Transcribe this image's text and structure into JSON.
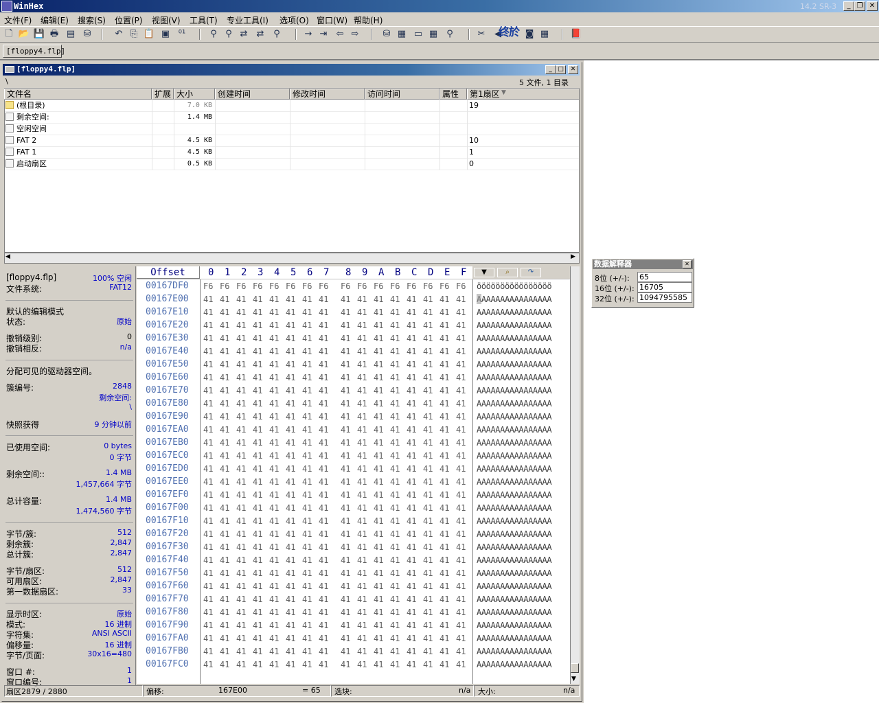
{
  "app": {
    "title": "WinHex",
    "version": "14.2 SR-3"
  },
  "menu": [
    "文件(F)",
    "编辑(E)",
    "搜索(S)",
    "位置(P)",
    "视图(V)",
    "工具(T)",
    "专业工具(I)",
    "选项(O)",
    "窗口(W)",
    "帮助(H)"
  ],
  "toolbar_icons": [
    "new-icon",
    "open-icon",
    "save-icon",
    "print-icon",
    "properties-icon",
    "open-disk-icon",
    "undo-icon",
    "copy-icon",
    "paste-icon",
    "clipboard-data-icon",
    "write-bytes-icon",
    "find-text-icon",
    "find-hex-icon",
    "replace-text-icon",
    "replace-hex-icon",
    "find-again-icon",
    "goto-offset-icon",
    "goto-sector-icon",
    "back-icon",
    "forward-icon",
    "disk-editor-icon",
    "ram-editor-icon",
    "drive-icon",
    "calculator-icon",
    "analyze-icon",
    "snapshot-icon",
    "specialist-icon",
    "camera-icon",
    "table-icon",
    "help-book-icon"
  ],
  "toolbar_overlay_text": "终於",
  "tab": {
    "label": "[floppy4.flp]"
  },
  "doc": {
    "title": "[floppy4.flp]",
    "path": "\\",
    "count": "5 文件, 1 目录",
    "columns": [
      "文件名",
      "扩展",
      "大小",
      "创建时间",
      "修改时间",
      "访问时间",
      "属性",
      "第1扇区"
    ],
    "files": [
      {
        "name": "(根目录)",
        "ext": "",
        "size": "7.0 KB",
        "sector": "19",
        "folder": true
      },
      {
        "name": "剩余空间:",
        "ext": "",
        "size": "1.4 MB",
        "sector": ""
      },
      {
        "name": "空闲空间",
        "ext": "",
        "size": "",
        "sector": ""
      },
      {
        "name": "FAT 2",
        "ext": "",
        "size": "4.5 KB",
        "sector": "10"
      },
      {
        "name": "FAT 1",
        "ext": "",
        "size": "4.5 KB",
        "sector": "1"
      },
      {
        "name": "启动扇区",
        "ext": "",
        "size": "0.5 KB",
        "sector": "0"
      }
    ]
  },
  "info": {
    "file_label": "[floppy4.flp]",
    "file_value": "100% 空闲",
    "fs_label": "文件系统:",
    "fs_value": "FAT12",
    "edit_mode_label": "默认的编辑模式",
    "state_label": "状态:",
    "state_value": "原始",
    "undo_level_label": "撤销级别:",
    "undo_level_value": "0",
    "undo_reverse_label": "撤销相反:",
    "undo_reverse_value": "n/a",
    "alloc_label": "分配可见的驱动器空间。",
    "cluster_label": "簇编号:",
    "cluster_value": "2848",
    "cluster_sub": "剩余空间:",
    "cluster_path": "\\",
    "snapshot_label": "快照获得",
    "snapshot_value": "9 分钟以前",
    "used_label": "已使用空间:",
    "used_bytes": "0 bytes",
    "used_bytes2": "0 字节",
    "free_label": "剩余空间::",
    "free_mb": "1.4 MB",
    "free_bytes": "1,457,664 字节",
    "total_label": "总计容量:",
    "total_mb": "1.4 MB",
    "total_bytes": "1,474,560 字节",
    "bpc_label": "字节/簇:",
    "bpc_value": "512",
    "free_clusters_label": "剩余簇:",
    "free_clusters_value": "2,847",
    "total_clusters_label": "总计簇:",
    "total_clusters_value": "2,847",
    "bps_label": "字节/扇区:",
    "bps_value": "512",
    "usable_sectors_label": "可用扇区:",
    "usable_sectors_value": "2,847",
    "first_data_label": "第一数据扇区:",
    "first_data_value": "33",
    "time_label": "显示时区:",
    "time_value": "原始",
    "mode_label": "模式:",
    "mode_value": "16 进制",
    "charset_label": "字符集:",
    "charset_value": "ANSI ASCII",
    "offsets_label": "偏移量:",
    "offsets_value": "16 进制",
    "bpp_label": "字节/页面:",
    "bpp_value": "30x16=480",
    "window_label": "窗口 #:",
    "window_value": "1",
    "window_no_label": "窗口编号:",
    "window_no_value": "1"
  },
  "hex": {
    "offset_header": "Offset",
    "columns": [
      "0",
      "1",
      "2",
      "3",
      "4",
      "5",
      "6",
      "7",
      "8",
      "9",
      "A",
      "B",
      "C",
      "D",
      "E",
      "F"
    ],
    "rows": [
      {
        "offset": "00167DF0",
        "bytes": [
          "F6",
          "F6",
          "F6",
          "F6",
          "F6",
          "F6",
          "F6",
          "F6",
          "F6",
          "F6",
          "F6",
          "F6",
          "F6",
          "F6",
          "F6",
          "F6"
        ],
        "ascii": "öööööööööööööööö"
      },
      {
        "offset": "00167E00",
        "bytes": [
          "41",
          "41",
          "41",
          "41",
          "41",
          "41",
          "41",
          "41",
          "41",
          "41",
          "41",
          "41",
          "41",
          "41",
          "41",
          "41"
        ],
        "ascii": "AAAAAAAAAAAAAAAA"
      },
      {
        "offset": "00167E10",
        "bytes": [
          "41",
          "41",
          "41",
          "41",
          "41",
          "41",
          "41",
          "41",
          "41",
          "41",
          "41",
          "41",
          "41",
          "41",
          "41",
          "41"
        ],
        "ascii": "AAAAAAAAAAAAAAAA"
      },
      {
        "offset": "00167E20",
        "bytes": [
          "41",
          "41",
          "41",
          "41",
          "41",
          "41",
          "41",
          "41",
          "41",
          "41",
          "41",
          "41",
          "41",
          "41",
          "41",
          "41"
        ],
        "ascii": "AAAAAAAAAAAAAAAA"
      },
      {
        "offset": "00167E30",
        "bytes": [
          "41",
          "41",
          "41",
          "41",
          "41",
          "41",
          "41",
          "41",
          "41",
          "41",
          "41",
          "41",
          "41",
          "41",
          "41",
          "41"
        ],
        "ascii": "AAAAAAAAAAAAAAAA"
      },
      {
        "offset": "00167E40",
        "bytes": [
          "41",
          "41",
          "41",
          "41",
          "41",
          "41",
          "41",
          "41",
          "41",
          "41",
          "41",
          "41",
          "41",
          "41",
          "41",
          "41"
        ],
        "ascii": "AAAAAAAAAAAAAAAA"
      },
      {
        "offset": "00167E50",
        "bytes": [
          "41",
          "41",
          "41",
          "41",
          "41",
          "41",
          "41",
          "41",
          "41",
          "41",
          "41",
          "41",
          "41",
          "41",
          "41",
          "41"
        ],
        "ascii": "AAAAAAAAAAAAAAAA"
      },
      {
        "offset": "00167E60",
        "bytes": [
          "41",
          "41",
          "41",
          "41",
          "41",
          "41",
          "41",
          "41",
          "41",
          "41",
          "41",
          "41",
          "41",
          "41",
          "41",
          "41"
        ],
        "ascii": "AAAAAAAAAAAAAAAA"
      },
      {
        "offset": "00167E70",
        "bytes": [
          "41",
          "41",
          "41",
          "41",
          "41",
          "41",
          "41",
          "41",
          "41",
          "41",
          "41",
          "41",
          "41",
          "41",
          "41",
          "41"
        ],
        "ascii": "AAAAAAAAAAAAAAAA"
      },
      {
        "offset": "00167E80",
        "bytes": [
          "41",
          "41",
          "41",
          "41",
          "41",
          "41",
          "41",
          "41",
          "41",
          "41",
          "41",
          "41",
          "41",
          "41",
          "41",
          "41"
        ],
        "ascii": "AAAAAAAAAAAAAAAA"
      },
      {
        "offset": "00167E90",
        "bytes": [
          "41",
          "41",
          "41",
          "41",
          "41",
          "41",
          "41",
          "41",
          "41",
          "41",
          "41",
          "41",
          "41",
          "41",
          "41",
          "41"
        ],
        "ascii": "AAAAAAAAAAAAAAAA"
      },
      {
        "offset": "00167EA0",
        "bytes": [
          "41",
          "41",
          "41",
          "41",
          "41",
          "41",
          "41",
          "41",
          "41",
          "41",
          "41",
          "41",
          "41",
          "41",
          "41",
          "41"
        ],
        "ascii": "AAAAAAAAAAAAAAAA"
      },
      {
        "offset": "00167EB0",
        "bytes": [
          "41",
          "41",
          "41",
          "41",
          "41",
          "41",
          "41",
          "41",
          "41",
          "41",
          "41",
          "41",
          "41",
          "41",
          "41",
          "41"
        ],
        "ascii": "AAAAAAAAAAAAAAAA"
      },
      {
        "offset": "00167EC0",
        "bytes": [
          "41",
          "41",
          "41",
          "41",
          "41",
          "41",
          "41",
          "41",
          "41",
          "41",
          "41",
          "41",
          "41",
          "41",
          "41",
          "41"
        ],
        "ascii": "AAAAAAAAAAAAAAAA"
      },
      {
        "offset": "00167ED0",
        "bytes": [
          "41",
          "41",
          "41",
          "41",
          "41",
          "41",
          "41",
          "41",
          "41",
          "41",
          "41",
          "41",
          "41",
          "41",
          "41",
          "41"
        ],
        "ascii": "AAAAAAAAAAAAAAAA"
      },
      {
        "offset": "00167EE0",
        "bytes": [
          "41",
          "41",
          "41",
          "41",
          "41",
          "41",
          "41",
          "41",
          "41",
          "41",
          "41",
          "41",
          "41",
          "41",
          "41",
          "41"
        ],
        "ascii": "AAAAAAAAAAAAAAAA"
      },
      {
        "offset": "00167EF0",
        "bytes": [
          "41",
          "41",
          "41",
          "41",
          "41",
          "41",
          "41",
          "41",
          "41",
          "41",
          "41",
          "41",
          "41",
          "41",
          "41",
          "41"
        ],
        "ascii": "AAAAAAAAAAAAAAAA"
      },
      {
        "offset": "00167F00",
        "bytes": [
          "41",
          "41",
          "41",
          "41",
          "41",
          "41",
          "41",
          "41",
          "41",
          "41",
          "41",
          "41",
          "41",
          "41",
          "41",
          "41"
        ],
        "ascii": "AAAAAAAAAAAAAAAA"
      },
      {
        "offset": "00167F10",
        "bytes": [
          "41",
          "41",
          "41",
          "41",
          "41",
          "41",
          "41",
          "41",
          "41",
          "41",
          "41",
          "41",
          "41",
          "41",
          "41",
          "41"
        ],
        "ascii": "AAAAAAAAAAAAAAAA"
      },
      {
        "offset": "00167F20",
        "bytes": [
          "41",
          "41",
          "41",
          "41",
          "41",
          "41",
          "41",
          "41",
          "41",
          "41",
          "41",
          "41",
          "41",
          "41",
          "41",
          "41"
        ],
        "ascii": "AAAAAAAAAAAAAAAA"
      },
      {
        "offset": "00167F30",
        "bytes": [
          "41",
          "41",
          "41",
          "41",
          "41",
          "41",
          "41",
          "41",
          "41",
          "41",
          "41",
          "41",
          "41",
          "41",
          "41",
          "41"
        ],
        "ascii": "AAAAAAAAAAAAAAAA"
      },
      {
        "offset": "00167F40",
        "bytes": [
          "41",
          "41",
          "41",
          "41",
          "41",
          "41",
          "41",
          "41",
          "41",
          "41",
          "41",
          "41",
          "41",
          "41",
          "41",
          "41"
        ],
        "ascii": "AAAAAAAAAAAAAAAA"
      },
      {
        "offset": "00167F50",
        "bytes": [
          "41",
          "41",
          "41",
          "41",
          "41",
          "41",
          "41",
          "41",
          "41",
          "41",
          "41",
          "41",
          "41",
          "41",
          "41",
          "41"
        ],
        "ascii": "AAAAAAAAAAAAAAAA"
      },
      {
        "offset": "00167F60",
        "bytes": [
          "41",
          "41",
          "41",
          "41",
          "41",
          "41",
          "41",
          "41",
          "41",
          "41",
          "41",
          "41",
          "41",
          "41",
          "41",
          "41"
        ],
        "ascii": "AAAAAAAAAAAAAAAA"
      },
      {
        "offset": "00167F70",
        "bytes": [
          "41",
          "41",
          "41",
          "41",
          "41",
          "41",
          "41",
          "41",
          "41",
          "41",
          "41",
          "41",
          "41",
          "41",
          "41",
          "41"
        ],
        "ascii": "AAAAAAAAAAAAAAAA"
      },
      {
        "offset": "00167F80",
        "bytes": [
          "41",
          "41",
          "41",
          "41",
          "41",
          "41",
          "41",
          "41",
          "41",
          "41",
          "41",
          "41",
          "41",
          "41",
          "41",
          "41"
        ],
        "ascii": "AAAAAAAAAAAAAAAA"
      },
      {
        "offset": "00167F90",
        "bytes": [
          "41",
          "41",
          "41",
          "41",
          "41",
          "41",
          "41",
          "41",
          "41",
          "41",
          "41",
          "41",
          "41",
          "41",
          "41",
          "41"
        ],
        "ascii": "AAAAAAAAAAAAAAAA"
      },
      {
        "offset": "00167FA0",
        "bytes": [
          "41",
          "41",
          "41",
          "41",
          "41",
          "41",
          "41",
          "41",
          "41",
          "41",
          "41",
          "41",
          "41",
          "41",
          "41",
          "41"
        ],
        "ascii": "AAAAAAAAAAAAAAAA"
      },
      {
        "offset": "00167FB0",
        "bytes": [
          "41",
          "41",
          "41",
          "41",
          "41",
          "41",
          "41",
          "41",
          "41",
          "41",
          "41",
          "41",
          "41",
          "41",
          "41",
          "41"
        ],
        "ascii": "AAAAAAAAAAAAAAAA"
      },
      {
        "offset": "00167FC0",
        "bytes": [
          "41",
          "41",
          "41",
          "41",
          "41",
          "41",
          "41",
          "41",
          "41",
          "41",
          "41",
          "41",
          "41",
          "41",
          "41",
          "41"
        ],
        "ascii": "AAAAAAAAAAAAAAAA"
      }
    ]
  },
  "status": {
    "sector": "扇区2879 / 2880",
    "offset_label": "偏移:",
    "offset_value": "167E00",
    "value": "= 65",
    "block_label": "选块:",
    "block_value": "n/a",
    "size_label": "大小:",
    "size_value": "n/a"
  },
  "interpreter": {
    "title": "数据解释器",
    "rows": [
      {
        "label": "8位 (+/-):",
        "value": "65"
      },
      {
        "label": "16位 (+/-):",
        "value": "16705"
      },
      {
        "label": "32位 (+/-):",
        "value": "1094795585"
      }
    ]
  }
}
